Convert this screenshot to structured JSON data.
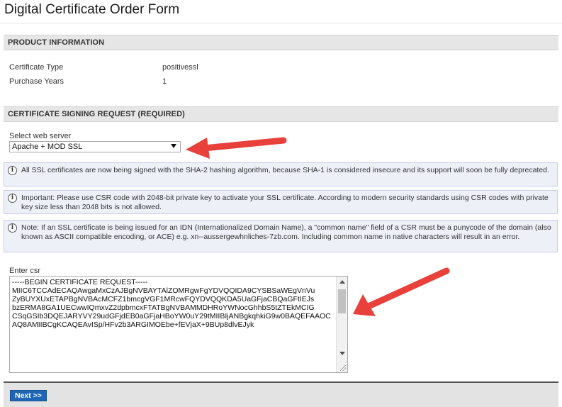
{
  "page": {
    "title": "Digital Certificate Order Form"
  },
  "product_info": {
    "header": "PRODUCT INFORMATION",
    "rows": [
      {
        "label": "Certificate Type",
        "value": "positivessl"
      },
      {
        "label": "Purchase Years",
        "value": "1"
      }
    ]
  },
  "csr_section": {
    "header": "CERTIFICATE SIGNING REQUEST (REQUIRED)",
    "server_label": "Select web server",
    "server_selected": "Apache + MOD SSL",
    "notes": [
      "All SSL certificates are now being signed with the SHA-2 hashing algorithm, because SHA-1 is considered insecure and its support will soon be fully deprecated.",
      "Important: Please use CSR code with 2048-bit private key to activate your SSL certificate. According to modern security standards using CSR codes with private key size less than 2048 bits is not allowed.",
      "Note: If an SSL certificate is being issued for an IDN (Internationalized Domain Name), a \"common name\" field of a CSR must be a punycode of the domain (also known as ASCII compatible encoding, or ACE) e.g. xn--aussergewhnliches-7zb.com. Including common name in native characters will result in an error."
    ],
    "csr_label": "Enter csr",
    "csr_value": "-----BEGIN CERTIFICATE REQUEST-----\nMIIC6TCCAdECAQAwgaMxCzAJBgNVBAYTAlZOMRgwFgYDVQQIDA9CYSBSaWEgVnVu\nZyBUYXUxETAPBgNVBAcMCFZ1bmcgVGF1MRcwFQYDVQQKDA5UaGFjaCBQaGFtIEJs\nbzERMA8GA1UECwwIQmxvZ2dpbmcxFTATBgNVBAMMDHRoYWNocGhhbS5tZTEkMCIG\nCSqGSIb3DQEJARYVY29udGFjdEB0aGFjaHBoYW0uY29tMIIBIjANBgkqhkiG9w0BAQEFAAOCAQ8AMIIBCgKCAQEAvISp/HFv2b3ARGIMOEbe+fEVjaX+9BUp8dlvEJyk"
  },
  "footer": {
    "next_label": "Next >>"
  },
  "colors": {
    "accent_button": "#1f66b7",
    "note_background": "#eef0f8",
    "annotation_arrow": "#e8413b"
  }
}
